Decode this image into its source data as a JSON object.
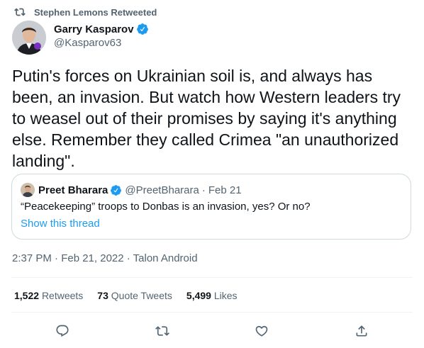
{
  "retweet_context": {
    "text": "Stephen Lemons Retweeted",
    "icon": "retweet-icon"
  },
  "author": {
    "name": "Garry Kasparov",
    "handle": "@Kasparov63",
    "verified": true
  },
  "tweet": {
    "text": "Putin's forces on Ukrainian soil is, and always has been, an invasion. But watch how Western leaders try to weasel out of their promises by saying it's anything else. Remember they called Crimea \"an unauthorized landing\"."
  },
  "quoted": {
    "name": "Preet Bharara",
    "handle": "@PreetBharara",
    "separator": "·",
    "date": "Feb 21",
    "text": "“Peacekeeping” troops to Donbas is an invasion, yes? Or no?",
    "link": "Show this thread"
  },
  "timestamp": "2:37 PM · Feb 21, 2022 · Talon Android",
  "stats": {
    "retweets_count": "1,522",
    "retweets_label": "Retweets",
    "quotes_count": "73",
    "quotes_label": "Quote Tweets",
    "likes_count": "5,499",
    "likes_label": "Likes"
  },
  "actions": [
    "reply-icon",
    "retweet-icon",
    "like-icon",
    "share-icon"
  ],
  "colors": {
    "link": "#1d9bf0",
    "muted": "#536471",
    "text": "#0f1419",
    "border": "#cfd9de"
  }
}
